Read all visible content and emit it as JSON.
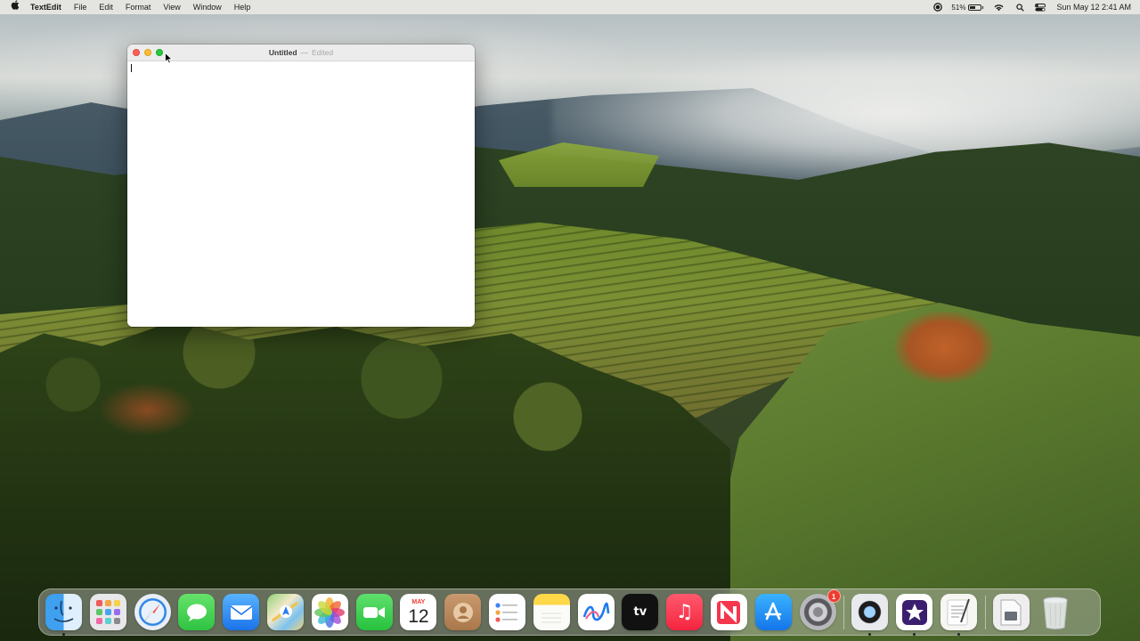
{
  "menubar": {
    "apple_icon": "apple-icon",
    "app_name": "TextEdit",
    "menus": [
      "File",
      "Edit",
      "Format",
      "View",
      "Window",
      "Help"
    ],
    "status": {
      "battery_percent_text": "51%",
      "battery_level": 0.51,
      "datetime": "Sun May 12  2:41 AM",
      "icons": [
        "record-icon",
        "battery-icon",
        "wifi-icon",
        "spotlight-icon",
        "control-center-icon"
      ]
    }
  },
  "window": {
    "title": "Untitled",
    "separator": "—",
    "edited_label": "Edited",
    "document_text": ""
  },
  "dock": {
    "apps": [
      {
        "id": "finder",
        "label": "Finder",
        "running": true
      },
      {
        "id": "launchpad",
        "label": "Launchpad",
        "running": false
      },
      {
        "id": "safari",
        "label": "Safari",
        "running": false
      },
      {
        "id": "messages",
        "label": "Messages",
        "running": false
      },
      {
        "id": "mail",
        "label": "Mail",
        "running": false
      },
      {
        "id": "maps",
        "label": "Maps",
        "running": false
      },
      {
        "id": "photos",
        "label": "Photos",
        "running": false
      },
      {
        "id": "facetime",
        "label": "FaceTime",
        "running": false
      },
      {
        "id": "calendar",
        "label": "Calendar",
        "running": false,
        "month": "MAY",
        "day": "12"
      },
      {
        "id": "contacts",
        "label": "Contacts",
        "running": false
      },
      {
        "id": "reminders",
        "label": "Reminders",
        "running": false
      },
      {
        "id": "notes",
        "label": "Notes",
        "running": false
      },
      {
        "id": "freeform",
        "label": "Freeform",
        "running": false
      },
      {
        "id": "appletv",
        "label": "TV",
        "running": false,
        "glyph": "tv"
      },
      {
        "id": "music",
        "label": "Music",
        "running": false
      },
      {
        "id": "news",
        "label": "News",
        "running": false
      },
      {
        "id": "appstore",
        "label": "App Store",
        "running": false
      },
      {
        "id": "settings",
        "label": "System Settings",
        "running": false,
        "badge": "1"
      }
    ],
    "recent_apps": [
      {
        "id": "quicktime",
        "label": "QuickTime Player",
        "running": true
      },
      {
        "id": "imovie",
        "label": "iMovie",
        "running": true
      },
      {
        "id": "textedit",
        "label": "TextEdit",
        "running": true
      }
    ],
    "stacks": [
      {
        "id": "downloads",
        "label": "Downloads"
      },
      {
        "id": "trash",
        "label": "Trash"
      }
    ]
  },
  "colors": {
    "close": "#fe5f57",
    "minimize": "#febc2e",
    "maximize": "#28c840",
    "badge": "#f03a2e"
  }
}
